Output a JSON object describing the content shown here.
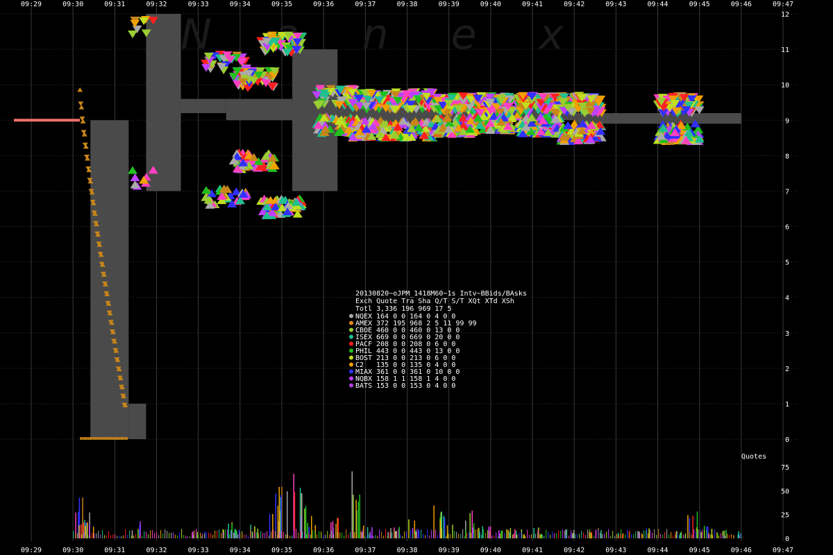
{
  "chart_data": [
    {
      "type": "scatter",
      "panel": "quotes",
      "watermark": "Nanex",
      "x_ticks": [
        "09:29",
        "09:30",
        "09:31",
        "09:32",
        "09:33",
        "09:34",
        "09:35",
        "09:36",
        "09:37",
        "09:38",
        "09:39",
        "09:40",
        "09:41",
        "09:42",
        "09:43",
        "09:44",
        "09:45",
        "09:46",
        "09:47"
      ],
      "y_ticks": [
        "0",
        "1",
        "2",
        "3",
        "4",
        "5",
        "6",
        "7",
        "8",
        "9",
        "10",
        "11",
        "12"
      ],
      "ylim": [
        0,
        12
      ],
      "grid": true,
      "nbbo_spread": [
        {
          "t": "09:30:25",
          "low": 0,
          "high": 9.0
        },
        {
          "t": "09:31:20",
          "low": 0,
          "high": 1.0
        },
        {
          "t": "09:31:45",
          "low": 7.0,
          "high": 12.0
        },
        {
          "t": "09:32:35",
          "low": 9.2,
          "high": 9.6
        },
        {
          "t": "09:33:40",
          "low": 9.0,
          "high": 9.6
        },
        {
          "t": "09:35:15",
          "low": 7.0,
          "high": 11.0
        },
        {
          "t": "09:36:20",
          "low": 9.0,
          "high": 9.5
        },
        {
          "t": "09:37:00",
          "low": 8.8,
          "high": 9.7
        },
        {
          "t": "09:38:30",
          "low": 9.0,
          "high": 9.4
        },
        {
          "t": "09:40:00",
          "low": 9.0,
          "high": 9.3
        },
        {
          "t": "09:42:00",
          "low": 8.9,
          "high": 9.2
        },
        {
          "t": "09:46:00",
          "low": 8.9,
          "high": 9.2
        }
      ],
      "prior_level": {
        "t_start": "09:29:00",
        "t_end": "09:30:10",
        "value": 9.0,
        "color": "#f07070"
      },
      "dropping_quotes_amex": {
        "color": "#c8861a",
        "t_start": "09:30:10",
        "t_end": "09:31:15",
        "from": 9.8,
        "to": 0.9
      },
      "label_quotes": "Quotes"
    },
    {
      "type": "bar",
      "panel": "volume",
      "y_ticks": [
        "0",
        "25",
        "50",
        "75"
      ],
      "ylim": [
        0,
        80
      ],
      "spikes": [
        {
          "t": "09:30:10",
          "v": 45
        },
        {
          "t": "09:30:15",
          "v": 30
        },
        {
          "t": "09:30:25",
          "v": 20
        },
        {
          "t": "09:31:30",
          "v": 18
        },
        {
          "t": "09:33:00",
          "v": 8
        },
        {
          "t": "09:33:40",
          "v": 18
        },
        {
          "t": "09:33:55",
          "v": 12
        },
        {
          "t": "09:34:20",
          "v": 15
        },
        {
          "t": "09:34:50",
          "v": 50
        },
        {
          "t": "09:35:00",
          "v": 55
        },
        {
          "t": "09:35:20",
          "v": 70
        },
        {
          "t": "09:35:40",
          "v": 35
        },
        {
          "t": "09:36:15",
          "v": 28
        },
        {
          "t": "09:36:45",
          "v": 80
        },
        {
          "t": "09:37:00",
          "v": 22
        },
        {
          "t": "09:37:40",
          "v": 15
        },
        {
          "t": "09:38:10",
          "v": 20
        },
        {
          "t": "09:38:40",
          "v": 35
        },
        {
          "t": "09:39:00",
          "v": 28
        },
        {
          "t": "09:39:30",
          "v": 30
        },
        {
          "t": "09:39:50",
          "v": 14
        },
        {
          "t": "09:40:20",
          "v": 12
        },
        {
          "t": "09:40:40",
          "v": 10
        },
        {
          "t": "09:41:10",
          "v": 12
        },
        {
          "t": "09:41:50",
          "v": 10
        },
        {
          "t": "09:42:30",
          "v": 12
        },
        {
          "t": "09:43:10",
          "v": 10
        },
        {
          "t": "09:43:40",
          "v": 12
        },
        {
          "t": "09:44:30",
          "v": 8
        },
        {
          "t": "09:44:50",
          "v": 30
        },
        {
          "t": "09:45:10",
          "v": 15
        },
        {
          "t": "09:45:30",
          "v": 10
        },
        {
          "t": "09:45:50",
          "v": 8
        }
      ]
    }
  ],
  "stats": {
    "header": "20130820~oJPM_1418M60~1s Intv~BBids/BAsks",
    "columns": "Exch Quote Tra Sha  Q/T   S/T  XQt XTd XSh",
    "total": "Totl 3,336 196 969   17    5",
    "rows": [
      {
        "exch": "NQEX",
        "color": "#aaaaaa",
        "line": "164   0   0   164    0   4   0   0"
      },
      {
        "exch": "AMEX",
        "color": "#e08a20",
        "line": "372 195 968     2    5  11  99  99"
      },
      {
        "exch": "CBOE",
        "color": "#9acd32",
        "line": "460   0   0   460    0  13   0   0"
      },
      {
        "exch": "ISEX",
        "color": "#20c090",
        "line": "669   0   0   669    0  20   0   0"
      },
      {
        "exch": "PACF",
        "color": "#ff2020",
        "line": "208   0   0   208    0   6   0   0"
      },
      {
        "exch": "PHIL",
        "color": "#20c020",
        "line": "443   0   0   443    0  13   0   0"
      },
      {
        "exch": "BOST",
        "color": "#c0e020",
        "line": "213   0   0   213    0   6   0   0"
      },
      {
        "exch": "C2",
        "color": "#f0a000",
        "line": "135   0   0   135    0   4   0   0"
      },
      {
        "exch": "MIAX",
        "color": "#3030ff",
        "line": "361   0   0   361    0  10   0   0"
      },
      {
        "exch": "NQBX",
        "color": "#c040ff",
        "line": "158   1   1   158    1   4   0   0"
      },
      {
        "exch": "BATS",
        "color": "#b040e0",
        "line": "153   0   0   153    0   4   0   0"
      }
    ]
  },
  "colors": {
    "background": "#000000",
    "grid": "#3a3a3a",
    "spread": "#4a4a4a",
    "exchanges": [
      "#9acd32",
      "#20c020",
      "#20c090",
      "#ff2020",
      "#ff40c0",
      "#c040ff",
      "#f0a000",
      "#c8861a",
      "#aaaaaa",
      "#3030ff",
      "#c0e020"
    ]
  }
}
